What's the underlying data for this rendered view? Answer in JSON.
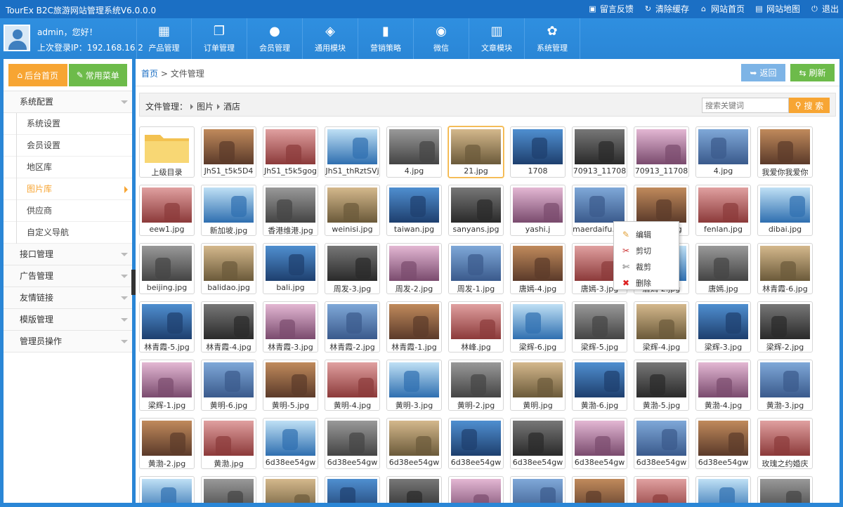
{
  "app_title": "TourEx B2C旅游网站管理系统V6.0.0.0",
  "top_links": [
    {
      "label": "留言反馈",
      "icon": "chat-icon"
    },
    {
      "label": "清除缓存",
      "icon": "refresh-icon"
    },
    {
      "label": "网站首页",
      "icon": "home-icon"
    },
    {
      "label": "网站地图",
      "icon": "map-icon"
    },
    {
      "label": "退出",
      "icon": "power-icon"
    }
  ],
  "user": {
    "greeting": "admin，您好！",
    "last_login": "上次登录IP：192.168.16.2"
  },
  "nav": [
    {
      "label": "产品管理",
      "icon": "grid-icon"
    },
    {
      "label": "订单管理",
      "icon": "copy-icon"
    },
    {
      "label": "会员管理",
      "icon": "user-icon"
    },
    {
      "label": "通用模块",
      "icon": "tag-icon"
    },
    {
      "label": "营销策略",
      "icon": "bar-chart-icon"
    },
    {
      "label": "微信",
      "icon": "wechat-icon"
    },
    {
      "label": "文章模块",
      "icon": "book-icon"
    },
    {
      "label": "系统管理",
      "icon": "gear-icon"
    }
  ],
  "sidebar": {
    "home_btn": "后台首页",
    "fav_btn": "常用菜单",
    "group1": "系统配置",
    "sub": [
      "系统设置",
      "会员设置",
      "地区库",
      "图片库",
      "供应商",
      "自定义导航"
    ],
    "groups": [
      "接口管理",
      "广告管理",
      "友情链接",
      "模版管理",
      "管理员操作"
    ]
  },
  "breadcrumb": {
    "home": "首页",
    "sep": ">",
    "current": "文件管理"
  },
  "buttons": {
    "back": "返回",
    "refresh": "刷新"
  },
  "filebar": {
    "label": "文件管理：",
    "path": [
      "图片",
      "酒店"
    ]
  },
  "search": {
    "placeholder": "搜索关键词",
    "button": "搜 索"
  },
  "files": [
    "上级目录",
    "JhS1_t5k5D4",
    "JhS1_t5k5gog",
    "JhS1_thRztSVj",
    "4.jpg",
    "21.jpg",
    "1708",
    "70913_11708",
    "70913_11708",
    "4.jpg",
    "我爱你我爱你",
    "eew1.jpg",
    "新加坡.jpg",
    "香港维港.jpg",
    "weinisi.jpg",
    "taiwan.jpg",
    "sanyans.jpg",
    "yashi.j",
    "maerdaifu.jpg",
    "lundun.jpg",
    "fenlan.jpg",
    "dibai.jpg",
    "beijing.jpg",
    "balidao.jpg",
    "bali.jpg",
    "周发-3.jpg",
    "周发-2.jpg",
    "周发-1.jpg",
    "唐嫣-4.jpg",
    "唐嫣-3.jpg",
    "唐嫣-2.jpg",
    "唐嫣.jpg",
    "林青霞-6.jpg",
    "林青霞-5.jpg",
    "林青霞-4.jpg",
    "林青霞-3.jpg",
    "林青霞-2.jpg",
    "林青霞-1.jpg",
    "林峰.jpg",
    "梁辉-6.jpg",
    "梁辉-5.jpg",
    "梁辉-4.jpg",
    "梁辉-3.jpg",
    "梁辉-2.jpg",
    "梁辉-1.jpg",
    "黄明-6.jpg",
    "黄明-5.jpg",
    "黄明-4.jpg",
    "黄明-3.jpg",
    "黄明-2.jpg",
    "黄明.jpg",
    "黄渤-6.jpg",
    "黄渤-5.jpg",
    "黄渤-4.jpg",
    "黄渤-3.jpg",
    "黄渤-2.jpg",
    "黄渤.jpg",
    "6d38ee54gw",
    "6d38ee54gw",
    "6d38ee54gw",
    "6d38ee54gw",
    "6d38ee54gw",
    "6d38ee54gw",
    "6d38ee54gw",
    "6d38ee54gw",
    "玫瑰之约婚庆",
    "",
    "",
    "",
    "",
    "",
    "",
    "",
    "",
    "",
    "",
    ""
  ],
  "context_menu": [
    {
      "label": "编辑",
      "icon": "edit-icon"
    },
    {
      "label": "剪切",
      "icon": "scissors-icon"
    },
    {
      "label": "裁剪",
      "icon": "crop-icon"
    },
    {
      "label": "删除",
      "icon": "delete-icon"
    }
  ],
  "colors": {
    "accent_blue": "#2a86d6",
    "orange": "#f7a533",
    "green": "#6dbb4a"
  }
}
